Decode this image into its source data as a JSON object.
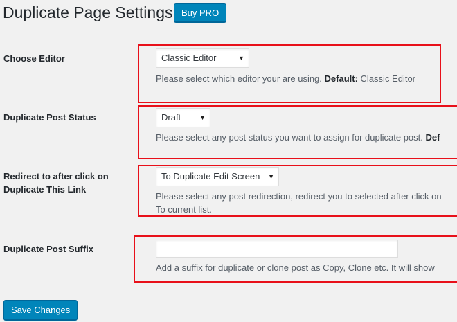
{
  "header": {
    "title": "Duplicate Page Settings",
    "buy_pro_label": "Buy PRO"
  },
  "rows": [
    {
      "label": "Choose Editor",
      "select_value": "Classic Editor",
      "description": "Please select which editor your are using.",
      "default_label": "Default:",
      "default_value": "Classic Editor"
    },
    {
      "label": "Duplicate Post Status",
      "select_value": "Draft",
      "description": "Please select any post status you want to assign for duplicate post.",
      "default_label": "Def"
    },
    {
      "label_line1": "Redirect to after click on",
      "label_line2": "Duplicate This Link",
      "select_value": "To Duplicate Edit Screen",
      "description_line1": "Please select any post redirection, redirect you to selected after click on",
      "description_line2": "To current list."
    },
    {
      "label": "Duplicate Post Suffix",
      "input_value": "",
      "description": "Add a suffix for duplicate or clone post as Copy, Clone etc. It will show"
    }
  ],
  "footer": {
    "save_label": "Save Changes"
  },
  "colors": {
    "accent": "#0085ba",
    "highlight": "#e8101a",
    "background": "#f1f1f1"
  }
}
